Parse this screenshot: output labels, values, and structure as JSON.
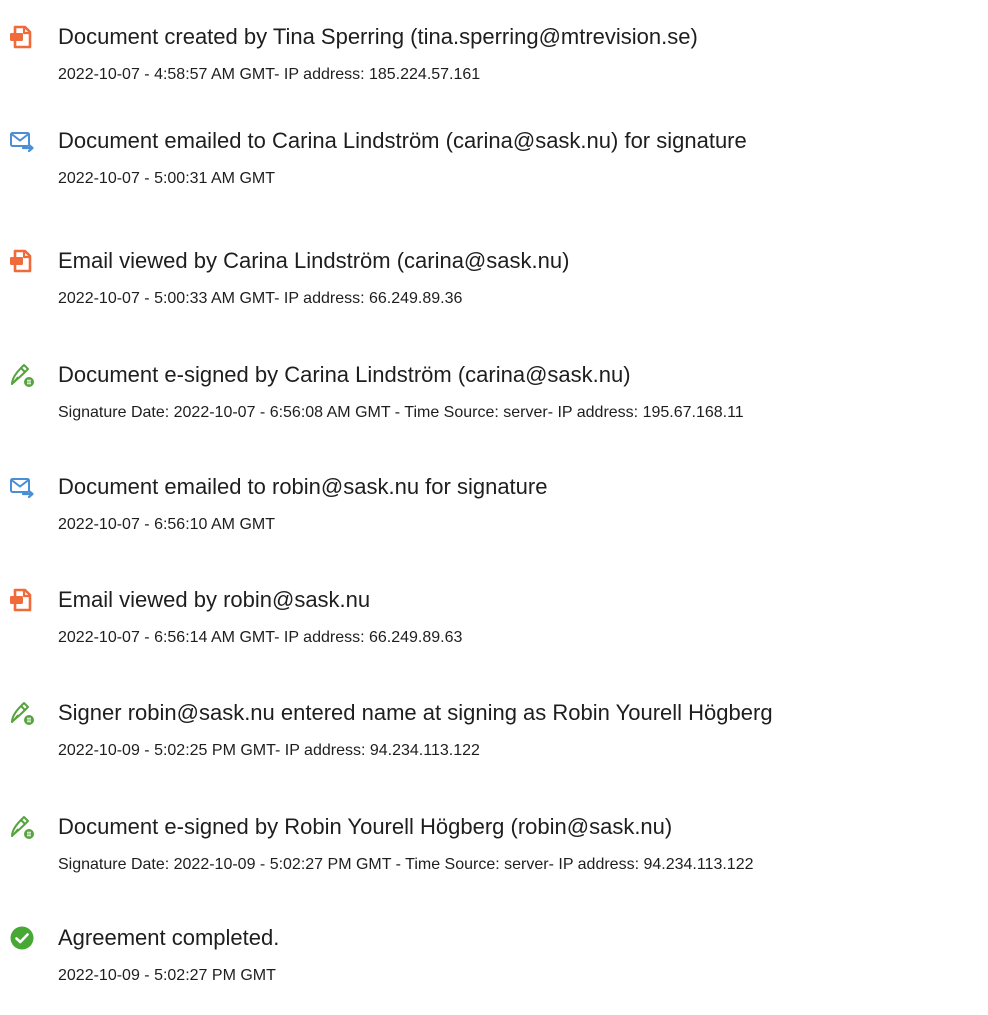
{
  "colors": {
    "created_icon": "#f06a3a",
    "email_icon": "#4a8fd6",
    "sign_icon": "#56a33f",
    "complete_icon": "#47a836",
    "text": "#1e1e1e"
  },
  "events": [
    {
      "icon": "document-icon",
      "title": "Document created by Tina Sperring (tina.sperring@mtrevision.se)",
      "detail": "2022-10-07 - 4:58:57 AM GMT- IP address: 185.224.57.161"
    },
    {
      "icon": "email-sent-icon",
      "title": "Document emailed to Carina Lindström (carina@sask.nu) for signature",
      "detail": "2022-10-07 - 5:00:31 AM GMT"
    },
    {
      "icon": "document-icon",
      "title": "Email viewed by Carina Lindström (carina@sask.nu)",
      "detail": "2022-10-07 - 5:00:33 AM GMT- IP address: 66.249.89.36"
    },
    {
      "icon": "pen-sign-icon",
      "title": "Document e-signed by Carina Lindström (carina@sask.nu)",
      "detail": "Signature Date: 2022-10-07 - 6:56:08 AM GMT - Time Source: server- IP address: 195.67.168.11"
    },
    {
      "icon": "email-sent-icon",
      "title": "Document emailed to robin@sask.nu for signature",
      "detail": "2022-10-07 - 6:56:10 AM GMT"
    },
    {
      "icon": "document-icon",
      "title": "Email viewed by robin@sask.nu",
      "detail": "2022-10-07 - 6:56:14 AM GMT- IP address: 66.249.89.63"
    },
    {
      "icon": "pen-sign-icon",
      "title": "Signer robin@sask.nu entered name at signing as Robin Yourell Högberg",
      "detail": "2022-10-09 - 5:02:25 PM GMT- IP address: 94.234.113.122"
    },
    {
      "icon": "pen-sign-icon",
      "title": "Document e-signed by Robin Yourell Högberg (robin@sask.nu)",
      "detail": "Signature Date: 2022-10-09 - 5:02:27 PM GMT - Time Source: server- IP address: 94.234.113.122"
    },
    {
      "icon": "check-circle-icon",
      "title": "Agreement completed.",
      "detail": "2022-10-09 - 5:02:27 PM GMT"
    }
  ]
}
